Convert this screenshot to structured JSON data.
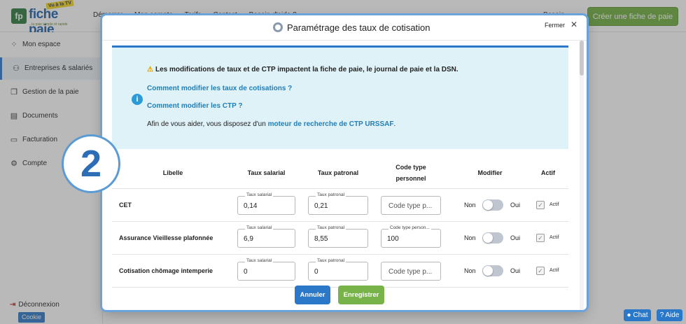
{
  "app": {
    "logo": {
      "brand": "fiche paie",
      "badge": "Vu à la TV",
      "tagline": "...la paie simple et rapide",
      "mark": "fp"
    },
    "top_nav": [
      "Démarrer",
      "Mon compte",
      "Tarifs",
      "Contact",
      "Besoin d'aide ?"
    ],
    "top_right": "Besoin",
    "cta_label": "Créer une fiche de paie",
    "cta_arrow": "→",
    "sidebar": [
      {
        "label": "Mon espace",
        "icon": "grid-icon",
        "glyph": "⁘"
      },
      {
        "label": "Entreprises & salariés",
        "icon": "users-icon",
        "glyph": "⚇"
      },
      {
        "label": "Gestion de la paie",
        "icon": "copy-icon",
        "glyph": "❐"
      },
      {
        "label": "Documents",
        "icon": "document-icon",
        "glyph": "▤"
      },
      {
        "label": "Facturation",
        "icon": "folder-icon",
        "glyph": "▭"
      },
      {
        "label": "Compte",
        "icon": "gear-icon",
        "glyph": "⚙"
      }
    ],
    "logout_label": "Déconnexion",
    "cookie_label": "Cookie",
    "chat_label": "Chat",
    "help_label": "Aide"
  },
  "modal": {
    "title": "Paramétrage des taux de cotisation",
    "close_label": "Fermer",
    "close_glyph": "✕",
    "info": {
      "warning": "Les modifications de taux et de CTP impactent la fiche de paie, le journal de paie et la DSN.",
      "link1": "Comment modifier les taux de cotisations ?",
      "link2": "Comment modifier les CTP ?",
      "help_prefix": "Afin de vous aider, vous disposez d'un",
      "help_link": "moteur de recherche de CTP URSSAF",
      "help_suffix": "."
    },
    "step_number": "2",
    "columns": {
      "libelle": "Libelle",
      "salarial": "Taux salarial",
      "patronal": "Taux patronal",
      "ctp_line1": "Code type",
      "ctp_line2": "personnel",
      "modifier": "Modifier",
      "actif": "Actif"
    },
    "field_labels": {
      "salarial": "Taux salarial",
      "patronal": "Taux patronal",
      "ctp": "Code type person...",
      "ctp_placeholder": "Code type p..."
    },
    "toggle_off_label": "Non",
    "toggle_on_label": "Oui",
    "actif_label": "Actif",
    "rows": [
      {
        "label": "CET",
        "salarial": "0,14",
        "patronal": "0,21",
        "ctp": "",
        "modifier": false,
        "actif": true
      },
      {
        "label": "Assurance Vieillesse plafonnée",
        "salarial": "6,9",
        "patronal": "8,55",
        "ctp": "100",
        "modifier": false,
        "actif": true
      },
      {
        "label": "Cotisation chômage intemperie",
        "salarial": "0",
        "patronal": "0",
        "ctp": "",
        "modifier": false,
        "actif": true
      }
    ],
    "cancel_label": "Annuler",
    "save_label": "Enregistrer"
  }
}
